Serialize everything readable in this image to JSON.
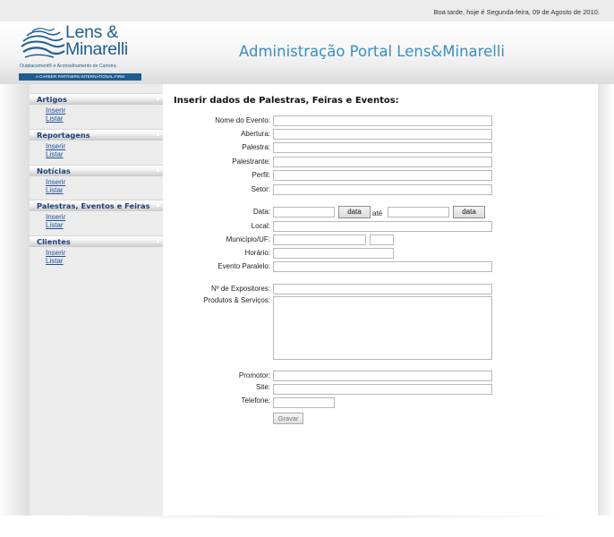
{
  "greeting": "Boa tarde, hoje é Segunda-feira, 09 de Agosto de 2010.",
  "logo": {
    "line1": "Lens &",
    "line2": "Minarelli",
    "tagline": "Outplacement® e Aconselhamento de Carreira",
    "firm": "A CAREER PARTNERS INTERNATIONAL FIRM"
  },
  "portal_title": "Administração Portal Lens&Minarelli",
  "sidebar": {
    "sections": [
      {
        "title": "Artigos",
        "links": [
          "Inserir",
          "Listar"
        ]
      },
      {
        "title": "Reportagens",
        "links": [
          "Inserir",
          "Listar"
        ]
      },
      {
        "title": "Notícias",
        "links": [
          "Inserir",
          "Listar"
        ]
      },
      {
        "title": "Palestras, Eventos e Feiras",
        "links": [
          "Inserir",
          "Listar"
        ]
      },
      {
        "title": "Clientes",
        "links": [
          "Inserir",
          "Listar"
        ]
      }
    ]
  },
  "form": {
    "title": "Inserir dados de Palestras, Feiras e Eventos:",
    "labels": {
      "nome_evento": "Nome do Evento:",
      "abertura": "Abertura:",
      "palestra": "Palestra:",
      "palestrante": "Palestrante:",
      "perfil": "Perfil:",
      "setor": "Setor:",
      "data": "Data:",
      "ate": "até",
      "local": "Local:",
      "municipio": "Município/UF:",
      "horario": "Horário:",
      "evento_paralelo": "Evento Paralelo:",
      "expositores": "Nº de Expositores:",
      "produtos": "Produtos & Serviços:",
      "promotor": "Promotor:",
      "site": "Site:",
      "telefone": "Telefone:"
    },
    "data_button": "data",
    "save_button": "Gravar"
  },
  "colors": {
    "brand_blue": "#1e5d92",
    "title_blue": "#3a8ec2",
    "menu_header_text": "#1e3f7a",
    "link_blue": "#1d4e9c"
  }
}
